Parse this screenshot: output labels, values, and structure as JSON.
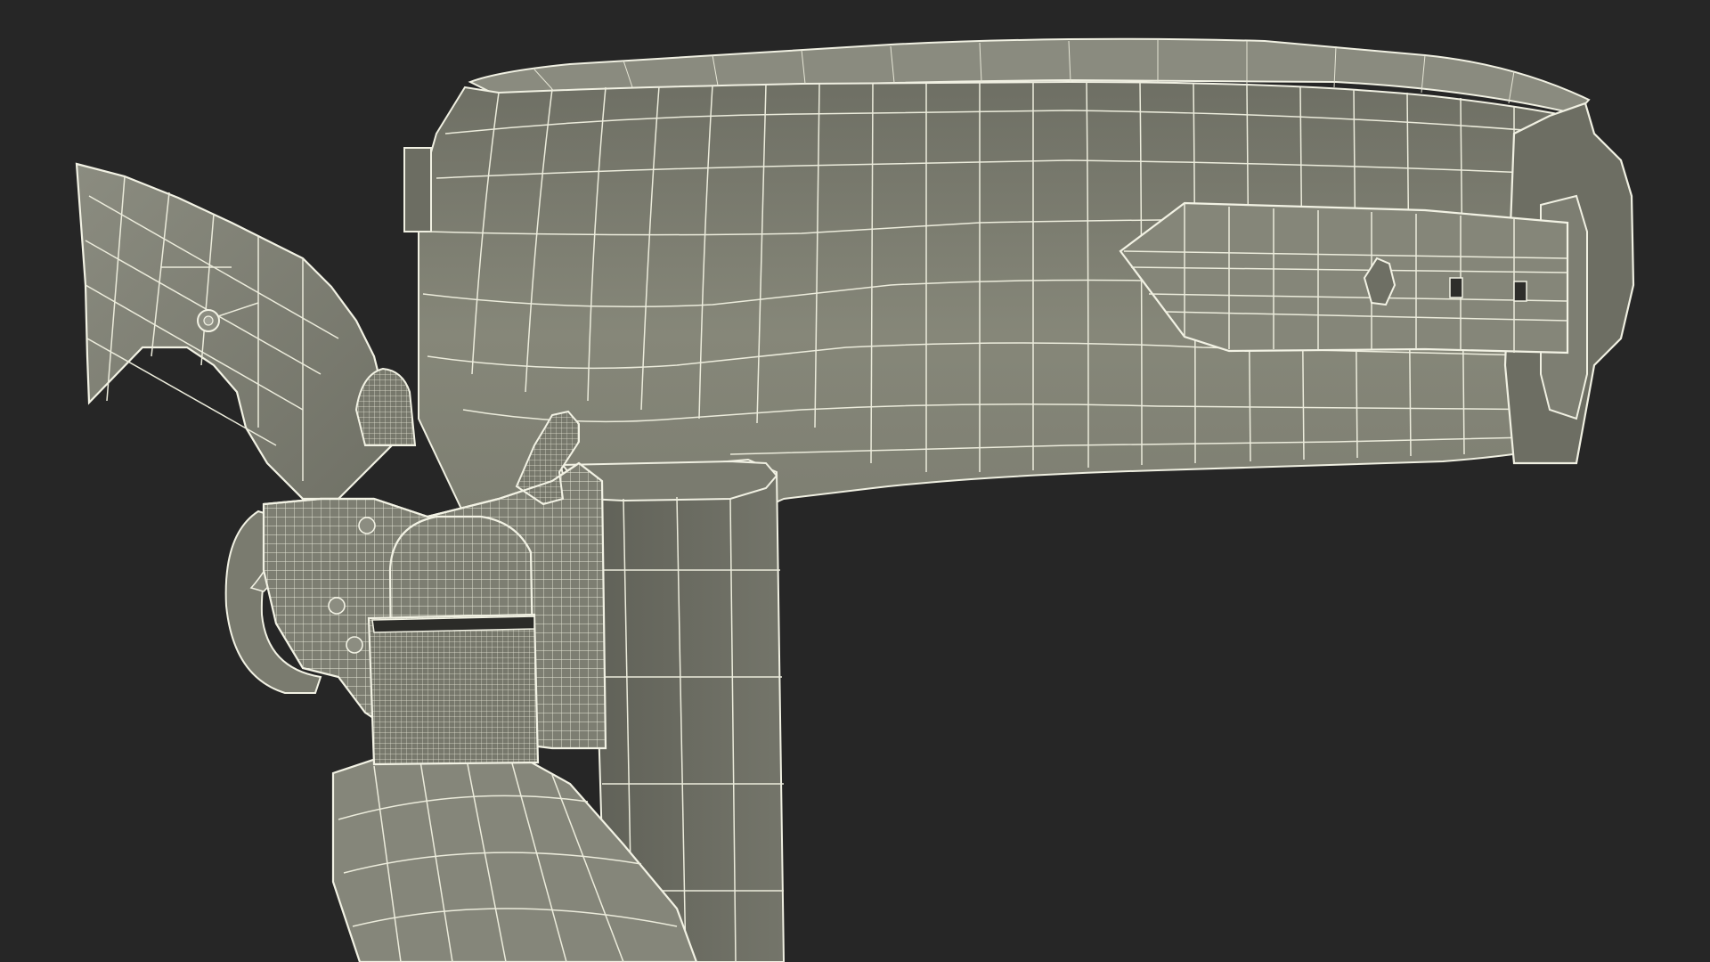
{
  "image": {
    "subject": "wireframe-3d-render",
    "colors": {
      "background": "#262626",
      "surface": "#7c7d71",
      "surface_dark": "#55564e",
      "surface_light": "#8a8b7f",
      "wire": "#ececdc"
    }
  }
}
